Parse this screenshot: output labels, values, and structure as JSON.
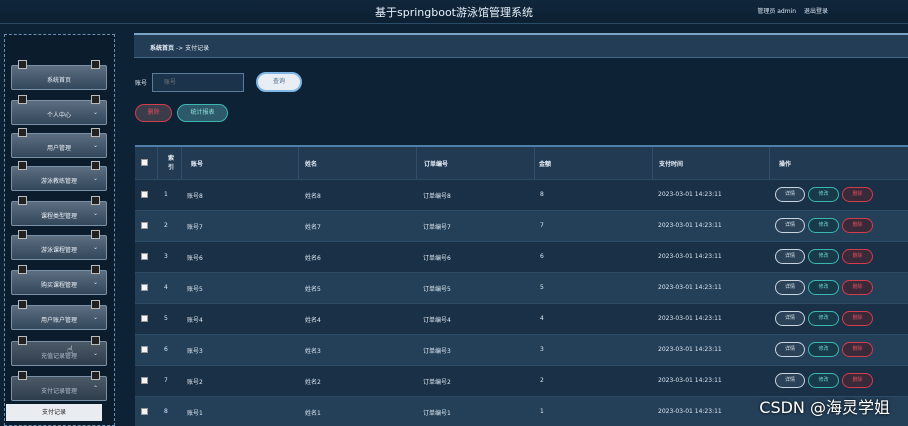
{
  "app": {
    "title": "基于springboot游泳馆管理系统",
    "admin_label": "管理员 admin",
    "logout_label": "退出登录"
  },
  "sidebar": {
    "items": [
      {
        "label": "系统首页",
        "chevron": ""
      },
      {
        "label": "个人中心",
        "chevron": "⌄"
      },
      {
        "label": "用户管理",
        "chevron": "⌄"
      },
      {
        "label": "游泳教练管理",
        "chevron": "⌄"
      },
      {
        "label": "课程类型管理",
        "chevron": "⌄"
      },
      {
        "label": "游泳课程管理",
        "chevron": "⌄"
      },
      {
        "label": "购买课程管理",
        "chevron": "⌄"
      },
      {
        "label": "用户账户管理",
        "chevron": "⌄"
      },
      {
        "label": "充值记录管理",
        "chevron": "⌄"
      },
      {
        "label": "支付记录管理",
        "chevron": "⌃"
      }
    ],
    "submenu_active": "支付记录"
  },
  "breadcrumb": {
    "home": "系统首页",
    "arrow": "->",
    "current": "支付记录"
  },
  "search": {
    "label": "账号",
    "placeholder": "账号",
    "query_button": "查询"
  },
  "actions": {
    "delete_button": "删除",
    "stats_button": "统计报表"
  },
  "table": {
    "headers": [
      "索引",
      "账号",
      "姓名",
      "订单编号",
      "金额",
      "支付时间",
      "操作"
    ],
    "rows": [
      {
        "index": "1",
        "account": "账号8",
        "name": "姓名8",
        "order": "订单编号8",
        "amount": "8",
        "time": "2023-03-01 14:23:11"
      },
      {
        "index": "2",
        "account": "账号7",
        "name": "姓名7",
        "order": "订单编号7",
        "amount": "7",
        "time": "2023-03-01 14:23:11"
      },
      {
        "index": "3",
        "account": "账号6",
        "name": "姓名6",
        "order": "订单编号6",
        "amount": "6",
        "time": "2023-03-01 14:23:11"
      },
      {
        "index": "4",
        "account": "账号5",
        "name": "姓名5",
        "order": "订单编号5",
        "amount": "5",
        "time": "2023-03-01 14:23:11"
      },
      {
        "index": "5",
        "account": "账号4",
        "name": "姓名4",
        "order": "订单编号4",
        "amount": "4",
        "time": "2023-03-01 14:23:11"
      },
      {
        "index": "6",
        "account": "账号3",
        "name": "姓名3",
        "order": "订单编号3",
        "amount": "3",
        "time": "2023-03-01 14:23:11"
      },
      {
        "index": "7",
        "account": "账号2",
        "name": "姓名2",
        "order": "订单编号2",
        "amount": "2",
        "time": "2023-03-01 14:23:11"
      },
      {
        "index": "8",
        "account": "账号1",
        "name": "姓名1",
        "order": "订单编号1",
        "amount": "1",
        "time": "2023-03-01 14:23:11"
      }
    ],
    "op_detail": "详情",
    "op_edit": "修改",
    "op_delete": "删除"
  },
  "watermark": "CSDN @海灵学姐",
  "colors": {
    "background": "#0e2235",
    "accent": "#7fb7e6",
    "danger": "#d23c4c",
    "teal": "#3ab8b0"
  }
}
